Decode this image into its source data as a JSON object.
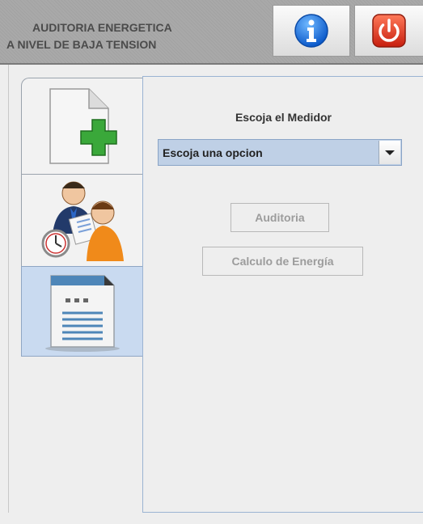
{
  "header": {
    "title_line1": "AUDITORIA ENERGETICA",
    "title_line2": "A NIVEL DE BAJA TENSION",
    "info_icon": "info-icon",
    "power_icon": "power-icon"
  },
  "tabs": [
    {
      "icon": "new-document-icon",
      "selected": false
    },
    {
      "icon": "people-audit-icon",
      "selected": false
    },
    {
      "icon": "report-document-icon",
      "selected": true
    }
  ],
  "panel": {
    "label": "Escoja el Medidor",
    "select_value": "Escoja una opcion",
    "auditoria_button": "Auditoria",
    "calculo_button": "Calculo de Energía"
  },
  "colors": {
    "header_bg": "#a9a9a9",
    "selected_tab": "#c9daf0",
    "combo_bg": "#bfd0e6"
  }
}
